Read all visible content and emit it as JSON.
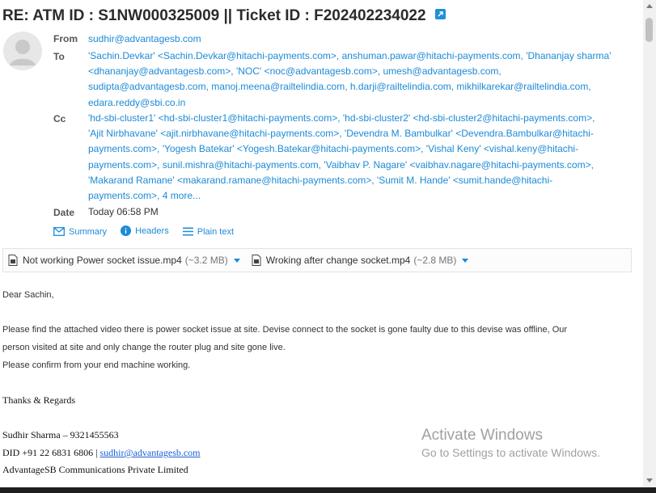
{
  "email": {
    "subject": "RE: ATM ID : S1NW000325009 || Ticket ID : F202402234022",
    "from_label": "From",
    "from": "sudhir@advantagesb.com",
    "to_label": "To",
    "to": [
      "'Sachin.Devkar' <Sachin.Devkar@hitachi-payments.com>, anshuman.pawar@hitachi-payments.com, 'Dhananjay sharma'",
      "<dhananjay@advantagesb.com>, 'NOC' <noc@advantagesb.com>, umesh@advantagesb.com,",
      "sudipta@advantagesb.com, manoj.meena@railtelindia.com, h.darji@railtelindia.com, mikhilkarekar@railtelindia.com,",
      "edara.reddy@sbi.co.in"
    ],
    "cc_label": "Cc",
    "cc": [
      "'hd-sbi-cluster1' <hd-sbi-cluster1@hitachi-payments.com>, 'hd-sbi-cluster2' <hd-sbi-cluster2@hitachi-payments.com>,",
      "'Ajit Nirbhavane' <ajit.nirbhavane@hitachi-payments.com>, 'Devendra M. Bambulkar' <Devendra.Bambulkar@hitachi-",
      "payments.com>, 'Yogesh Batekar' <Yogesh.Batekar@hitachi-payments.com>, 'Vishal Keny' <vishal.keny@hitachi-",
      "payments.com>, sunil.mishra@hitachi-payments.com, 'Vaibhav P. Nagare' <vaibhav.nagare@hitachi-payments.com>,",
      "'Makarand Ramane' <makarand.ramane@hitachi-payments.com>, 'Sumit M. Hande' <sumit.hande@hitachi-",
      "payments.com>, 4 more..."
    ],
    "date_label": "Date",
    "date": "Today 06:58 PM"
  },
  "header_links": {
    "summary": "Summary",
    "headers": "Headers",
    "plain_text": "Plain text"
  },
  "attachments": [
    {
      "name": "Not working Power socket issue.mp4",
      "size": "(~3.2 MB)"
    },
    {
      "name": "Wroking after change socket.mp4",
      "size": "(~2.8 MB)"
    }
  ],
  "body": {
    "greeting": "Dear Sachin,",
    "para1_line1": "Please find the attached video there is power socket issue at site. Devise connect to the socket is gone faulty due to this devise was offline, Our",
    "para1_line2": "person visited at site and only change the router plug and site gone live.",
    "para2": "Please confirm from your end machine working.",
    "signoff": "Thanks & Regards",
    "sig_name": "Sudhir Sharma – 9321455563",
    "sig_did_prefix": "DID +91 22 6831 6806 |",
    "sig_email": "sudhir@advantagesb.com",
    "sig_company": "AdvantageSB Communications Private Limited"
  },
  "watermark": {
    "title": "Activate Windows",
    "subtitle": "Go to Settings to activate Windows."
  },
  "colors": {
    "link": "#1c8ad6",
    "text": "#333333",
    "watermark": "#a0a0a0"
  }
}
